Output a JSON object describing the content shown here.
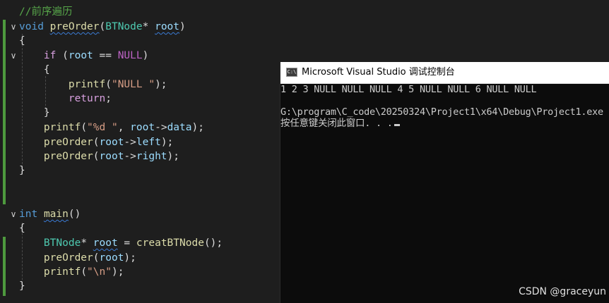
{
  "editor": {
    "lines": [
      [
        [
          "cmt",
          "//前序遍历"
        ]
      ],
      [
        [
          "kw",
          "void"
        ],
        [
          "punc",
          " "
        ],
        [
          "fn squig",
          "preOrder"
        ],
        [
          "punc",
          "("
        ],
        [
          "ty",
          "BTNode"
        ],
        [
          "punc",
          "* "
        ],
        [
          "var squig",
          "root"
        ],
        [
          "punc",
          ")"
        ]
      ],
      [
        [
          "punc",
          "{"
        ]
      ],
      [
        [
          "punc",
          "    "
        ],
        [
          "kw2",
          "if"
        ],
        [
          "punc",
          " ("
        ],
        [
          "var",
          "root"
        ],
        [
          "punc",
          " == "
        ],
        [
          "mac",
          "NULL"
        ],
        [
          "punc",
          ")"
        ]
      ],
      [
        [
          "punc",
          "    {"
        ]
      ],
      [
        [
          "punc",
          "        "
        ],
        [
          "fn",
          "printf"
        ],
        [
          "punc",
          "("
        ],
        [
          "str",
          "\"NULL \""
        ],
        [
          "punc",
          ");"
        ]
      ],
      [
        [
          "punc",
          "        "
        ],
        [
          "kw2",
          "return"
        ],
        [
          "punc",
          ";"
        ]
      ],
      [
        [
          "punc",
          "    }"
        ]
      ],
      [
        [
          "punc",
          "    "
        ],
        [
          "fn",
          "printf"
        ],
        [
          "punc",
          "("
        ],
        [
          "str",
          "\"%d \""
        ],
        [
          "punc",
          ", "
        ],
        [
          "var",
          "root"
        ],
        [
          "punc",
          "->"
        ],
        [
          "var",
          "data"
        ],
        [
          "punc",
          ");"
        ]
      ],
      [
        [
          "punc",
          "    "
        ],
        [
          "fn",
          "preOrder"
        ],
        [
          "punc",
          "("
        ],
        [
          "var",
          "root"
        ],
        [
          "punc",
          "->"
        ],
        [
          "var",
          "left"
        ],
        [
          "punc",
          ");"
        ]
      ],
      [
        [
          "punc",
          "    "
        ],
        [
          "fn",
          "preOrder"
        ],
        [
          "punc",
          "("
        ],
        [
          "var",
          "root"
        ],
        [
          "punc",
          "->"
        ],
        [
          "var",
          "right"
        ],
        [
          "punc",
          ");"
        ]
      ],
      [
        [
          "punc",
          "}"
        ]
      ],
      [],
      [],
      [
        [
          "kw",
          "int"
        ],
        [
          "punc",
          " "
        ],
        [
          "fn squig",
          "main"
        ],
        [
          "punc",
          "()"
        ]
      ],
      [
        [
          "punc",
          "{"
        ]
      ],
      [
        [
          "punc",
          "    "
        ],
        [
          "ty",
          "BTNode"
        ],
        [
          "punc",
          "* "
        ],
        [
          "var squig",
          "root"
        ],
        [
          "punc",
          " = "
        ],
        [
          "fn",
          "creatBTNode"
        ],
        [
          "punc",
          "();"
        ]
      ],
      [
        [
          "punc",
          "    "
        ],
        [
          "fn",
          "preOrder"
        ],
        [
          "punc",
          "("
        ],
        [
          "var",
          "root"
        ],
        [
          "punc",
          ");"
        ]
      ],
      [
        [
          "punc",
          "    "
        ],
        [
          "fn",
          "printf"
        ],
        [
          "punc",
          "("
        ],
        [
          "str",
          "\"\\n\""
        ],
        [
          "punc",
          ");"
        ]
      ],
      [
        [
          "punc",
          "}"
        ]
      ]
    ]
  },
  "console": {
    "title": "Microsoft Visual Studio 调试控制台",
    "icon_text": "C:\\",
    "output_line": "1 2 3 NULL NULL NULL 4 5 NULL NULL 6 NULL NULL",
    "exit_line": "G:\\program\\C_code\\20250324\\Project1\\x64\\Debug\\Project1.exe",
    "prompt_line": "按任意键关闭此窗口. . ."
  },
  "watermark": "CSDN @graceyun",
  "colors": {
    "editor_bg": "#1e1e1e",
    "console_bg": "#0c0c0c",
    "change_bar": "#4e9a3e",
    "keyword": "#569cd6",
    "function": "#dcdcaa",
    "type": "#4ec9b0",
    "variable": "#9cdcfe",
    "string": "#d69d85",
    "comment": "#57a64a"
  }
}
